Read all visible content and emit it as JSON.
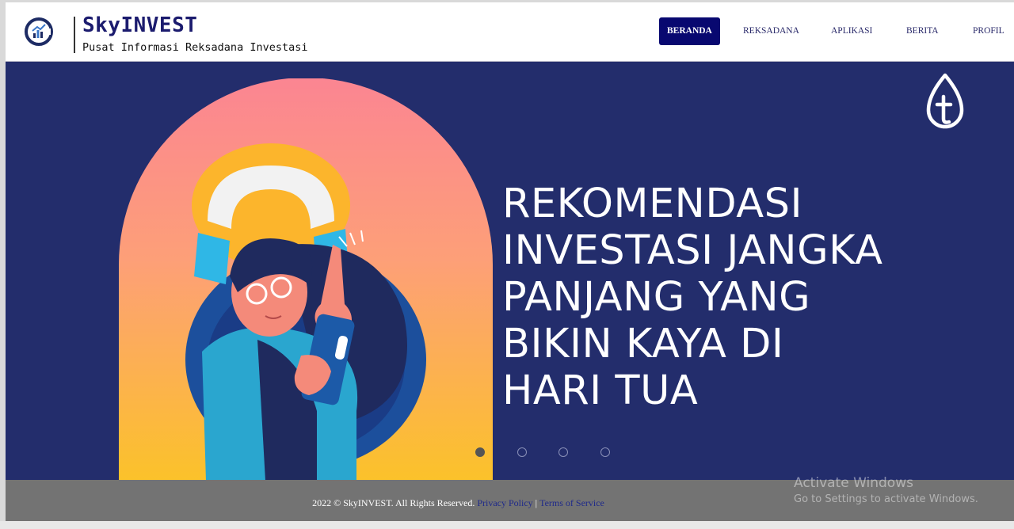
{
  "brand": {
    "title": "SkyINVEST",
    "subtitle": "Pusat Informasi Reksadana Investasi"
  },
  "nav": {
    "items": [
      {
        "label": "BERANDA",
        "active": true
      },
      {
        "label": "REKSADANA",
        "active": false
      },
      {
        "label": "APLIKASI",
        "active": false
      },
      {
        "label": "BERITA",
        "active": false
      },
      {
        "label": "PROFIL",
        "active": false
      }
    ]
  },
  "hero": {
    "lines": [
      "REKOMENDASI",
      "INVESTASI JANGKA",
      "PANJANG YANG",
      "BIKIN KAYA DI",
      "HARI TUA"
    ],
    "background_color": "#232d6c",
    "slides_total": 4,
    "active_slide": 1
  },
  "footer": {
    "copyright": "2022 © SkyINVEST. All Rights Reserved.",
    "privacy_label": "Privacy Policy",
    "separator": "|",
    "terms_label": "Terms of Service",
    "background_color": "#737373"
  },
  "watermark": {
    "title": "Activate Windows",
    "subtitle": "Go to Settings to activate Windows."
  },
  "icons": {
    "logo": "skyinvest-logo-icon",
    "hero_brand": "leaf-t-icon",
    "illustration": "woman-with-phone-illustration"
  }
}
